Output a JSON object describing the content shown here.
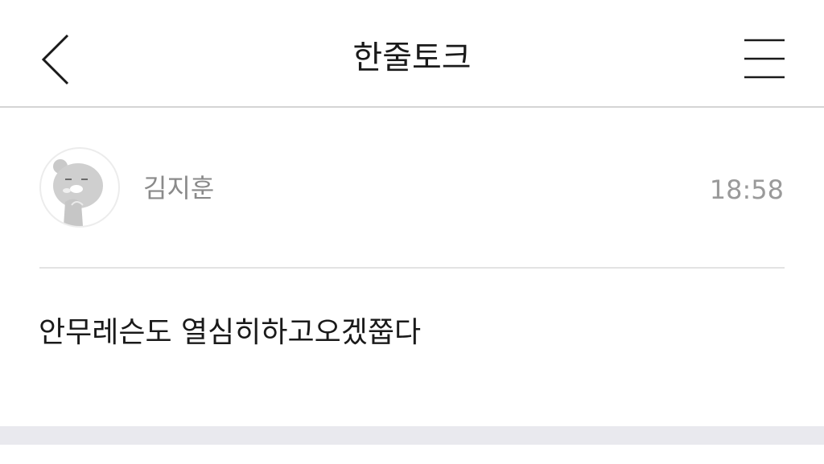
{
  "header": {
    "title": "한줄토크",
    "back_icon": "chevron-left-icon",
    "menu_icon": "hamburger-menu-icon"
  },
  "post": {
    "author_name": "김지훈",
    "time": "18:58",
    "avatar_icon": "character-avatar-icon",
    "message": "안무레슨도 열심히하고오겠쭙다"
  },
  "colors": {
    "title_text": "#1a1a1a",
    "meta_text": "#8a8a8a",
    "divider": "#e3e3e3",
    "header_border": "#d4d4d4",
    "footer_bar": "#e9e9ee"
  }
}
